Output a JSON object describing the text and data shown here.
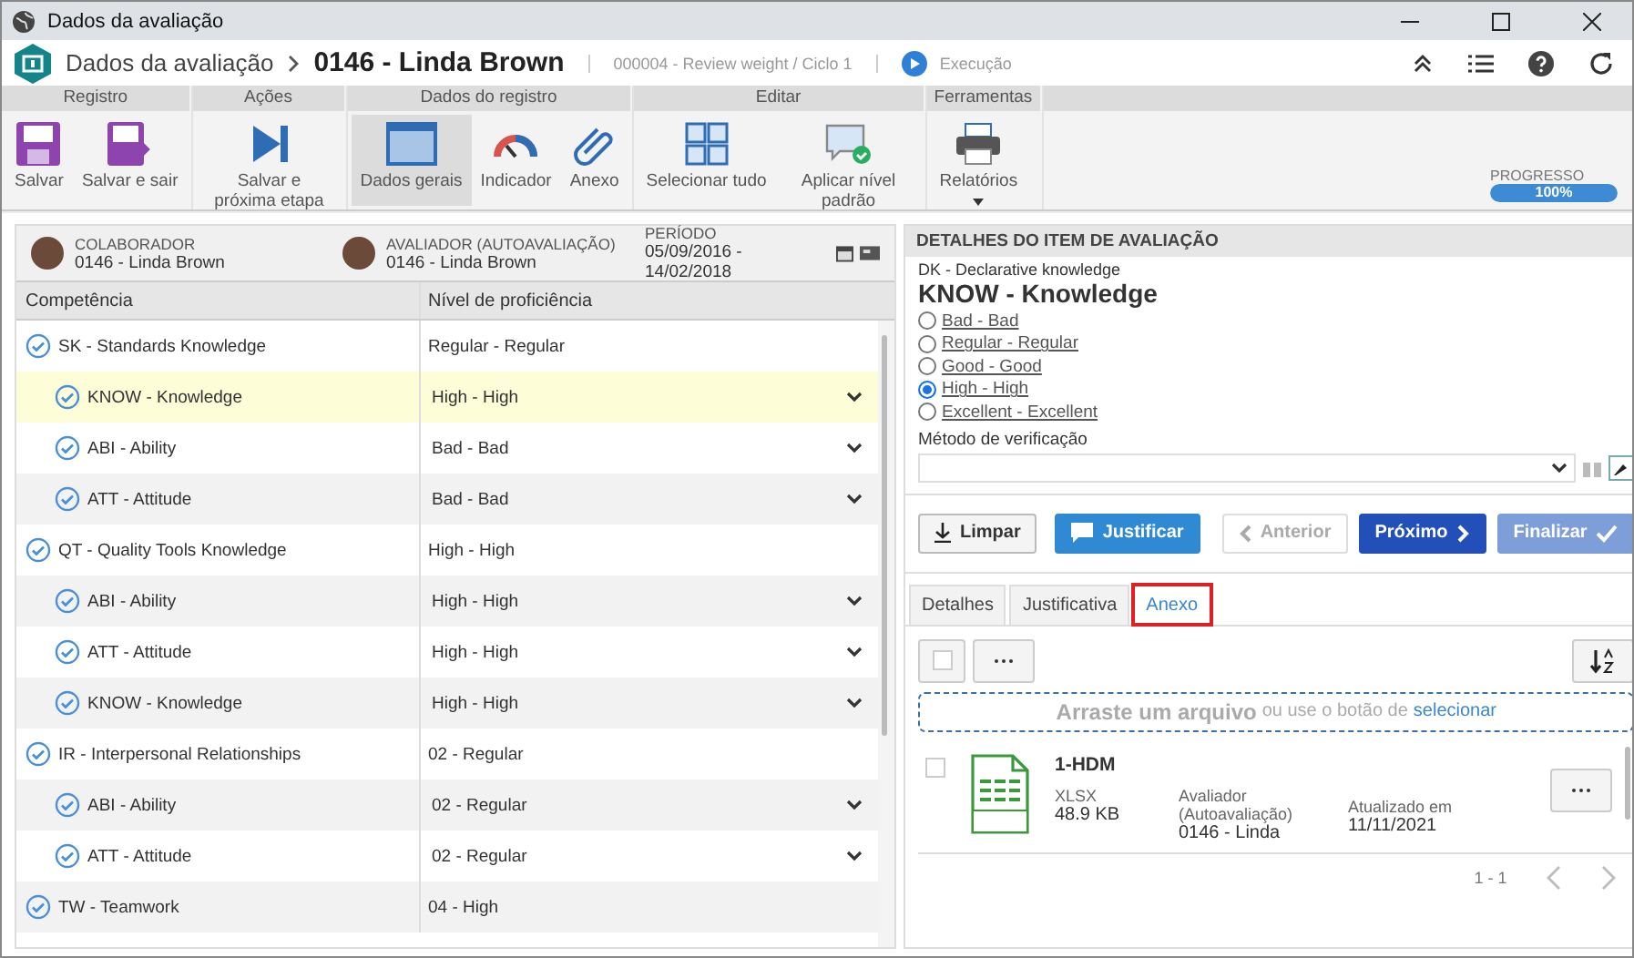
{
  "window": {
    "title": "Dados da avaliação"
  },
  "header": {
    "section": "Dados da avaliação",
    "record": "0146 - Linda Brown",
    "subtitle": "000004 - Review weight / Ciclo 1",
    "status": "Execução"
  },
  "ribbon": [
    {
      "label": "Registro",
      "buttons": [
        {
          "label": "Salvar",
          "selected": false
        },
        {
          "label": "Salvar e sair",
          "selected": false
        }
      ]
    },
    {
      "label": "Ações",
      "buttons": [
        {
          "label": "Salvar e próxima etapa",
          "selected": false
        }
      ]
    },
    {
      "label": "Dados do registro",
      "buttons": [
        {
          "label": "Dados gerais",
          "selected": true
        },
        {
          "label": "Indicador",
          "selected": false
        },
        {
          "label": "Anexo",
          "selected": false
        }
      ]
    },
    {
      "label": "Editar",
      "buttons": [
        {
          "label": "Selecionar tudo",
          "selected": false
        },
        {
          "label": "Aplicar nível padrão",
          "selected": false
        }
      ]
    },
    {
      "label": "Ferramentas",
      "buttons": [
        {
          "label": "Relatórios",
          "selected": false
        }
      ]
    }
  ],
  "progress": {
    "label": "PROGRESSO",
    "level": 1.0,
    "reading": "100%"
  },
  "info": [
    {
      "label": "COLABORADOR",
      "value": "0146 - Linda Brown"
    },
    {
      "label": "AVALIADOR (AUTOAVALIAÇÃO)",
      "value": "0146 - Linda Brown"
    },
    {
      "label": "PERÍODO",
      "value": "05/09/2016 - 14/02/2018"
    }
  ],
  "table": {
    "columns": [
      "Competência",
      "Nível de proficiência"
    ],
    "rows": [
      {
        "name": "SK - Standards Knowledge",
        "level": "Regular - Regular",
        "selected": false,
        "children": [
          {
            "name": "KNOW - Knowledge",
            "level": "High - High",
            "selected": true
          },
          {
            "name": "ABI - Ability",
            "level": "Bad - Bad",
            "selected": false
          },
          {
            "name": "ATT - Attitude",
            "level": "Bad - Bad",
            "selected": false
          }
        ]
      },
      {
        "name": "QT - Quality Tools Knowledge",
        "level": "High - High",
        "selected": false,
        "children": [
          {
            "name": "ABI - Ability",
            "level": "High - High",
            "selected": false
          },
          {
            "name": "ATT - Attitude",
            "level": "High - High",
            "selected": false
          },
          {
            "name": "KNOW - Knowledge",
            "level": "High - High",
            "selected": false
          }
        ]
      },
      {
        "name": "IR - Interpersonal Relationships",
        "level": "02 - Regular",
        "selected": false,
        "children": [
          {
            "name": "ABI - Ability",
            "level": "02 - Regular",
            "selected": false
          },
          {
            "name": "ATT - Attitude",
            "level": "02 - Regular",
            "selected": false
          }
        ]
      },
      {
        "name": "TW - Teamwork",
        "level": "04 - High",
        "selected": false
      }
    ]
  },
  "details": {
    "title": "DETALHES DO ITEM DE AVALIAÇÃO",
    "category": "DK - Declarative knowledge",
    "item": "KNOW - Knowledge",
    "options": [
      {
        "label": "Bad - Bad",
        "selected": false
      },
      {
        "label": "Regular - Regular",
        "selected": false
      },
      {
        "label": "Good - Good",
        "selected": false
      },
      {
        "label": "High - High",
        "selected": true
      },
      {
        "label": "Excellent - Excellent",
        "selected": false
      }
    ],
    "method_label": "Método de verificação",
    "actions": [
      {
        "label": "Limpar",
        "kind": "clear",
        "disabled": false
      },
      {
        "label": "Justificar",
        "kind": "justify",
        "disabled": false
      },
      {
        "label": "Anterior",
        "kind": "prev",
        "disabled": true
      },
      {
        "label": "Próximo",
        "kind": "next",
        "disabled": false
      },
      {
        "label": "Finalizar",
        "kind": "finish",
        "disabled": true
      }
    ],
    "tabs": [
      {
        "label": "Detalhes",
        "selected": false,
        "highlighted": false
      },
      {
        "label": "Justificativa",
        "selected": false,
        "highlighted": false
      },
      {
        "label": "Anexo",
        "selected": true,
        "highlighted": true
      }
    ],
    "select_all": {
      "checked": false
    },
    "dropzone": {
      "main": "Arraste um arquivo",
      "rest": "ou use o botão de",
      "link": "selecionar"
    },
    "files": [
      {
        "name": "1-HDM",
        "type": "XLSX",
        "size": "48.9 KB",
        "author_label": "Avaliador (Autoavaliação)",
        "author": "0146 - Linda",
        "date_label": "Atualizado em",
        "date": "11/11/2021",
        "checked": false
      }
    ],
    "pagination": "1 - 1"
  }
}
